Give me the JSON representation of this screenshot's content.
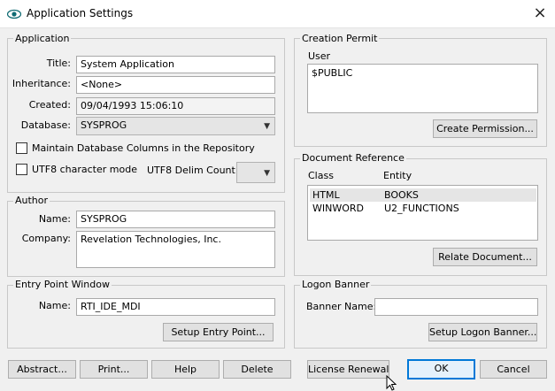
{
  "window": {
    "title": "Application Settings",
    "close_glyph": "×"
  },
  "application": {
    "legend": "Application",
    "title_label": "Title:",
    "title_value": "System Application",
    "inheritance_label": "Inheritance:",
    "inheritance_value": "<None>",
    "created_label": "Created:",
    "created_value": "09/04/1993 15:06:10",
    "database_label": "Database:",
    "database_value": "SYSPROG",
    "maintain_label": "Maintain Database Columns in the Repository",
    "utf8_label": "UTF8 character mode",
    "utf8_delim_label": "UTF8 Delim Count:"
  },
  "author": {
    "legend": "Author",
    "name_label": "Name:",
    "name_value": "SYSPROG",
    "company_label": "Company:",
    "company_value": "Revelation Technologies, Inc."
  },
  "entry_point": {
    "legend": "Entry Point Window",
    "name_label": "Name:",
    "name_value": "RTI_IDE_MDI",
    "setup_button": "Setup Entry Point..."
  },
  "creation_permit": {
    "legend": "Creation Permit",
    "user_header": "User",
    "users": [
      "$PUBLIC"
    ],
    "create_button": "Create Permission..."
  },
  "document_reference": {
    "legend": "Document Reference",
    "col_class": "Class",
    "col_entity": "Entity",
    "rows": [
      {
        "class": "HTML",
        "entity": "BOOKS"
      },
      {
        "class": "WINWORD",
        "entity": "U2_FUNCTIONS"
      }
    ],
    "relate_button": "Relate Document..."
  },
  "logon_banner": {
    "legend": "Logon Banner",
    "banner_label": "Banner Name:",
    "banner_value": "",
    "setup_button": "Setup Logon Banner..."
  },
  "buttons": {
    "abstract": "Abstract...",
    "print": "Print...",
    "help": "Help",
    "delete": "Delete",
    "license": "License Renewal",
    "ok": "OK",
    "cancel": "Cancel"
  },
  "icons": {
    "app": "eye-icon",
    "close": "close-icon",
    "dropdown": "chevron-down-icon",
    "cursor": "mouse-pointer-icon"
  },
  "colors": {
    "focus_border": "#0078d7",
    "selection": "#e5e5e5"
  }
}
